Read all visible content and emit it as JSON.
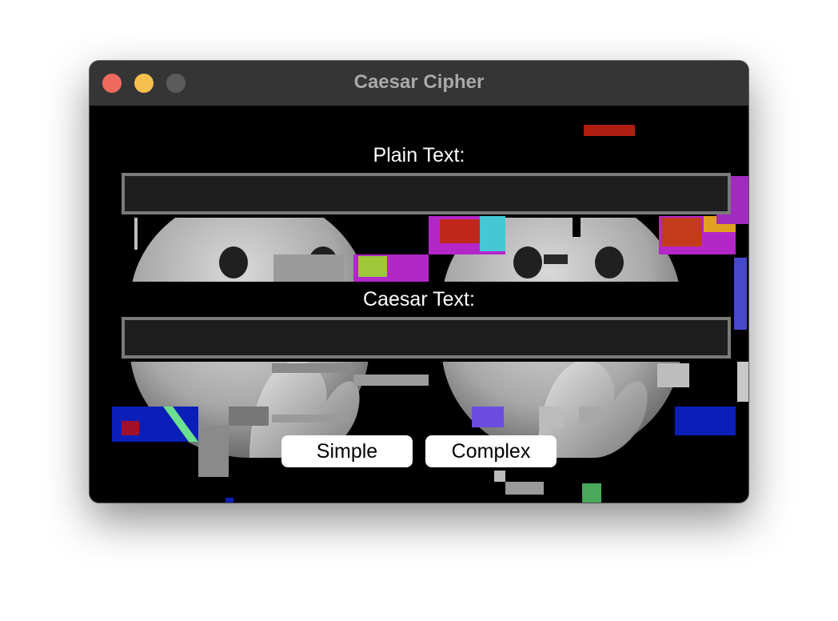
{
  "window": {
    "title": "Caesar Cipher"
  },
  "form": {
    "plain_label": "Plain Text:",
    "plain_value": "",
    "caesar_label": "Caesar Text:",
    "caesar_value": ""
  },
  "buttons": {
    "simple_label": "Simple",
    "complex_label": "Complex"
  },
  "colors": {
    "close": "#ee6a5e",
    "minimize": "#f5bf4f",
    "zoom": "#5b5b5b",
    "titlebar": "#353535",
    "field_border": "#7a7a7a"
  }
}
